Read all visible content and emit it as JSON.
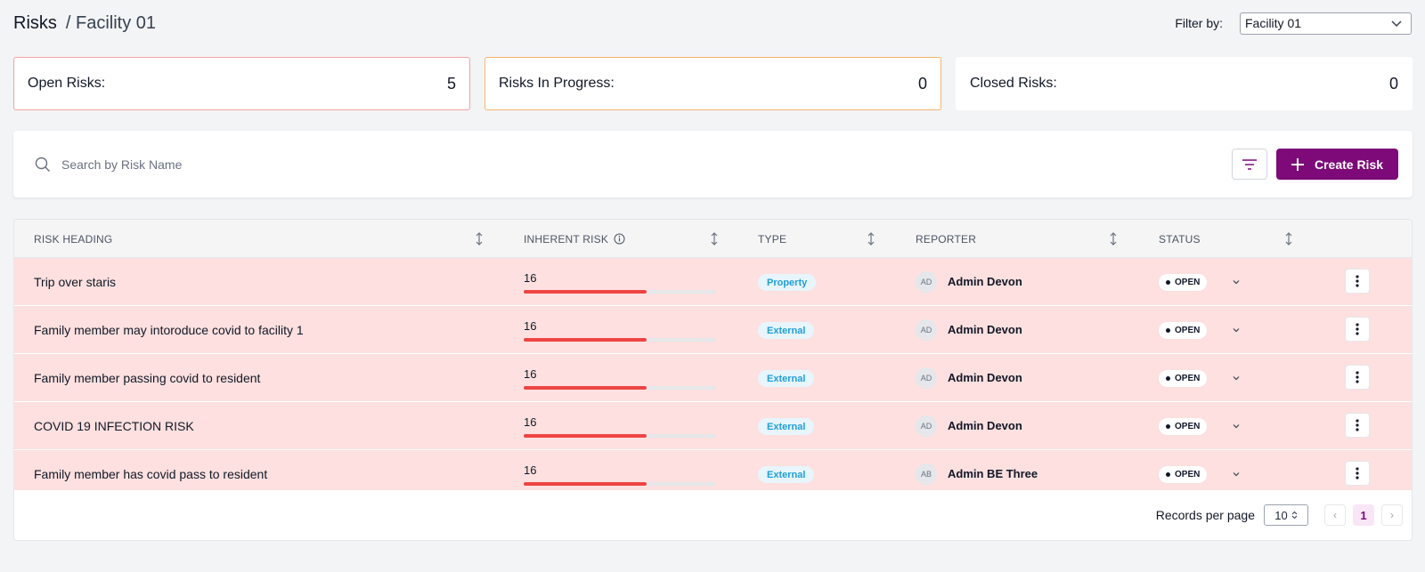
{
  "breadcrumb": {
    "root": "Risks",
    "current": "/ Facility 01"
  },
  "filter": {
    "label": "Filter by:",
    "value": "Facility 01"
  },
  "stats": [
    {
      "label": "Open Risks:",
      "value": "5"
    },
    {
      "label": "Risks In Progress:",
      "value": "0"
    },
    {
      "label": "Closed Risks:",
      "value": "0"
    }
  ],
  "search": {
    "placeholder": "Search by Risk Name"
  },
  "toolbar": {
    "create_label": "Create Risk"
  },
  "table": {
    "columns": {
      "heading": "RISK HEADING",
      "inherent": "INHERENT RISK",
      "type": "TYPE",
      "reporter": "REPORTER",
      "status": "STATUS"
    },
    "rows": [
      {
        "heading": "Trip over staris",
        "risk": "16",
        "risk_fraction": 0.64,
        "type": "Property",
        "initials": "AD",
        "reporter": "Admin Devon",
        "status": "OPEN"
      },
      {
        "heading": "Family member may intoroduce covid to facility 1",
        "risk": "16",
        "risk_fraction": 0.64,
        "type": "External",
        "initials": "AD",
        "reporter": "Admin Devon",
        "status": "OPEN"
      },
      {
        "heading": "Family member passing covid to resident",
        "risk": "16",
        "risk_fraction": 0.64,
        "type": "External",
        "initials": "AD",
        "reporter": "Admin Devon",
        "status": "OPEN"
      },
      {
        "heading": "COVID 19 INFECTION RISK",
        "risk": "16",
        "risk_fraction": 0.64,
        "type": "External",
        "initials": "AD",
        "reporter": "Admin Devon",
        "status": "OPEN"
      },
      {
        "heading": "Family member has covid pass to resident",
        "risk": "16",
        "risk_fraction": 0.64,
        "type": "External",
        "initials": "AB",
        "reporter": "Admin BE Three",
        "status": "OPEN"
      }
    ]
  },
  "pagination": {
    "label": "Records per page",
    "per_page": "10",
    "current_page": "1",
    "prev": "‹",
    "next": "›"
  },
  "colors": {
    "accent": "#7d0a78",
    "row_bg": "#fde0df",
    "risk_bar": "#ef4444",
    "type_text": "#1e9fd6"
  }
}
